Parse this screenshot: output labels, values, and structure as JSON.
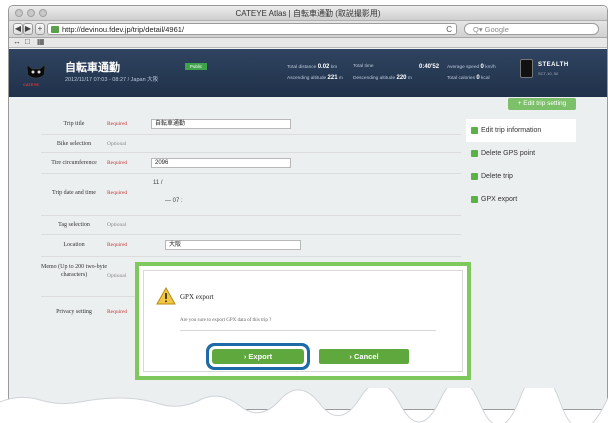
{
  "browser": {
    "window_title": "CATEYE Atlas | 自転車通勤 (取説撮影用)",
    "back_label": "◀",
    "forward_label": "▶",
    "add_label": "+",
    "url": "http://devinou.fdev.jp/trip/detail/4961/",
    "reload_label": "C",
    "search_placeholder": "Q▾ Google",
    "bookmark_icons": [
      "↔",
      "□",
      "▦"
    ]
  },
  "header": {
    "logo_text": "CATEYE",
    "trip_name": "自転車通勤",
    "trip_sub": "2012/11/17 07:03 - 08:27 / Japan 大阪",
    "tag": "Public",
    "stat1_label": "Total distance",
    "stat1_value": "0.02",
    "stat1_unit": "km",
    "stat2_label": "Total time",
    "stat2_value": "0:40'52",
    "stat3_label": "Average speed",
    "stat3_value": "0",
    "stat3_unit": "km/h",
    "stat4_label": "Ascending altitude",
    "stat4_value": "221",
    "stat4_unit": "m",
    "stat5_label": "Descending altitude",
    "stat5_value": "220",
    "stat5_unit": "m",
    "stat6_label": "Total calories",
    "stat6_value": "0",
    "stat6_unit": "kcal",
    "device_name": "STEALTH",
    "device_sub": "SCT-10, 50"
  },
  "top_button": "+ Edit trip setting",
  "form": {
    "trip_title_label": "Trip title",
    "trip_title_value": "自転車通勤",
    "bike_label": "Bike selection",
    "tire_label": "Tire circumference",
    "tire_value": "2096",
    "date_label": "Trip date and time",
    "date_line1": "11 / ",
    "date_line2": "— 07 : ",
    "tag_label": "Tag selection",
    "location_label": "Location",
    "location_value": "大阪",
    "memo_label": "Memo (Up to 200 two-byte characters)",
    "privacy_label": "Privacy setting",
    "required": "Required",
    "optional": "Optional"
  },
  "side_menu": [
    {
      "label": "Edit trip information"
    },
    {
      "label": "Delete GPS point"
    },
    {
      "label": "Delete trip"
    },
    {
      "label": "GPX export"
    }
  ],
  "dialog": {
    "title": "GPX export",
    "message": "Are you sure to export GPX data of this trip ?",
    "export_label": "› Export",
    "cancel_label": "› Cancel"
  },
  "colors": {
    "highlight_green": "#7ec85e",
    "button_green": "#5fa83e",
    "focus_blue": "#1c6aa8",
    "header_navy": "#2a3d58"
  }
}
